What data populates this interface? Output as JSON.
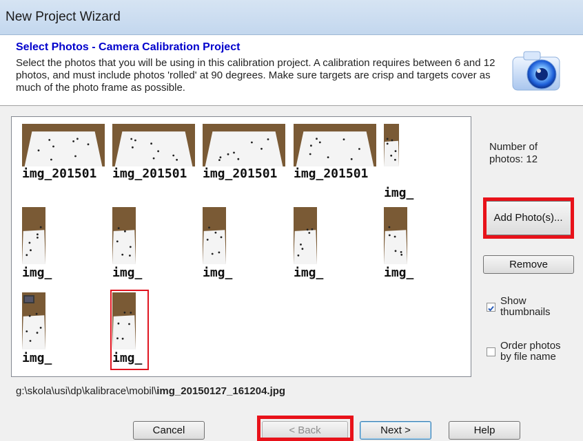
{
  "window": {
    "title": "New Project Wizard"
  },
  "header": {
    "heading": "Select Photos - Camera Calibration Project",
    "description": "Select the photos that you will be using in this calibration project. A calibration requires between 6 and 12 photos, and must include photos 'rolled' at 90 degrees. Make sure targets are crisp and targets cover as much of the photo frame as possible.",
    "icon": "camera-icon"
  },
  "photos": [
    {
      "label": "img_201501",
      "orientation": "landscape"
    },
    {
      "label": "img_201501",
      "orientation": "landscape"
    },
    {
      "label": "img_201501",
      "orientation": "landscape"
    },
    {
      "label": "img_201501",
      "orientation": "landscape"
    },
    {
      "label": "img_",
      "orientation": "portrait"
    },
    {
      "label": "img_",
      "orientation": "portrait"
    },
    {
      "label": "img_",
      "orientation": "portrait"
    },
    {
      "label": "img_",
      "orientation": "portrait"
    },
    {
      "label": "img_",
      "orientation": "portrait"
    },
    {
      "label": "img_",
      "orientation": "portrait"
    },
    {
      "label": "img_",
      "orientation": "portrait"
    },
    {
      "label": "img_",
      "orientation": "portrait",
      "selected": true
    }
  ],
  "sidebar": {
    "count_text": "Number of photos: 12",
    "add_label": "Add Photo(s)...",
    "remove_label": "Remove",
    "show_thumbnails": {
      "label": "Show thumbnails",
      "checked": true
    },
    "order_by_name": {
      "label": "Order photos by file name",
      "checked": false
    }
  },
  "selected_path": {
    "dir": "g:\\skola\\usi\\dp\\kalibrace\\mobil\\",
    "file": "img_20150127_161204.jpg"
  },
  "buttons": {
    "cancel": "Cancel",
    "back": "< Back",
    "next": "Next >",
    "help": "Help"
  },
  "colors": {
    "highlight": "#e8121a",
    "heading": "#0000cc",
    "floor": "#7a5a35",
    "paper": "#f4f4f4"
  }
}
